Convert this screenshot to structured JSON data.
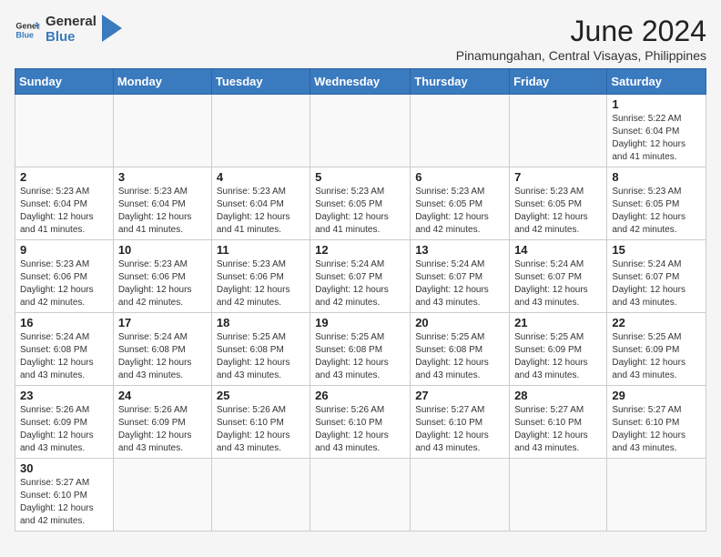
{
  "header": {
    "logo_general": "General",
    "logo_blue": "Blue",
    "month_year": "June 2024",
    "location": "Pinamungahan, Central Visayas, Philippines"
  },
  "days_of_week": [
    "Sunday",
    "Monday",
    "Tuesday",
    "Wednesday",
    "Thursday",
    "Friday",
    "Saturday"
  ],
  "weeks": [
    {
      "cells": [
        {
          "day": "",
          "info": ""
        },
        {
          "day": "",
          "info": ""
        },
        {
          "day": "",
          "info": ""
        },
        {
          "day": "",
          "info": ""
        },
        {
          "day": "",
          "info": ""
        },
        {
          "day": "",
          "info": ""
        },
        {
          "day": "1",
          "info": "Sunrise: 5:22 AM\nSunset: 6:04 PM\nDaylight: 12 hours and 41 minutes."
        }
      ]
    },
    {
      "cells": [
        {
          "day": "2",
          "info": "Sunrise: 5:23 AM\nSunset: 6:04 PM\nDaylight: 12 hours and 41 minutes."
        },
        {
          "day": "3",
          "info": "Sunrise: 5:23 AM\nSunset: 6:04 PM\nDaylight: 12 hours and 41 minutes."
        },
        {
          "day": "4",
          "info": "Sunrise: 5:23 AM\nSunset: 6:04 PM\nDaylight: 12 hours and 41 minutes."
        },
        {
          "day": "5",
          "info": "Sunrise: 5:23 AM\nSunset: 6:05 PM\nDaylight: 12 hours and 41 minutes."
        },
        {
          "day": "6",
          "info": "Sunrise: 5:23 AM\nSunset: 6:05 PM\nDaylight: 12 hours and 42 minutes."
        },
        {
          "day": "7",
          "info": "Sunrise: 5:23 AM\nSunset: 6:05 PM\nDaylight: 12 hours and 42 minutes."
        },
        {
          "day": "8",
          "info": "Sunrise: 5:23 AM\nSunset: 6:05 PM\nDaylight: 12 hours and 42 minutes."
        }
      ]
    },
    {
      "cells": [
        {
          "day": "9",
          "info": "Sunrise: 5:23 AM\nSunset: 6:06 PM\nDaylight: 12 hours and 42 minutes."
        },
        {
          "day": "10",
          "info": "Sunrise: 5:23 AM\nSunset: 6:06 PM\nDaylight: 12 hours and 42 minutes."
        },
        {
          "day": "11",
          "info": "Sunrise: 5:23 AM\nSunset: 6:06 PM\nDaylight: 12 hours and 42 minutes."
        },
        {
          "day": "12",
          "info": "Sunrise: 5:24 AM\nSunset: 6:07 PM\nDaylight: 12 hours and 42 minutes."
        },
        {
          "day": "13",
          "info": "Sunrise: 5:24 AM\nSunset: 6:07 PM\nDaylight: 12 hours and 43 minutes."
        },
        {
          "day": "14",
          "info": "Sunrise: 5:24 AM\nSunset: 6:07 PM\nDaylight: 12 hours and 43 minutes."
        },
        {
          "day": "15",
          "info": "Sunrise: 5:24 AM\nSunset: 6:07 PM\nDaylight: 12 hours and 43 minutes."
        }
      ]
    },
    {
      "cells": [
        {
          "day": "16",
          "info": "Sunrise: 5:24 AM\nSunset: 6:08 PM\nDaylight: 12 hours and 43 minutes."
        },
        {
          "day": "17",
          "info": "Sunrise: 5:24 AM\nSunset: 6:08 PM\nDaylight: 12 hours and 43 minutes."
        },
        {
          "day": "18",
          "info": "Sunrise: 5:25 AM\nSunset: 6:08 PM\nDaylight: 12 hours and 43 minutes."
        },
        {
          "day": "19",
          "info": "Sunrise: 5:25 AM\nSunset: 6:08 PM\nDaylight: 12 hours and 43 minutes."
        },
        {
          "day": "20",
          "info": "Sunrise: 5:25 AM\nSunset: 6:08 PM\nDaylight: 12 hours and 43 minutes."
        },
        {
          "day": "21",
          "info": "Sunrise: 5:25 AM\nSunset: 6:09 PM\nDaylight: 12 hours and 43 minutes."
        },
        {
          "day": "22",
          "info": "Sunrise: 5:25 AM\nSunset: 6:09 PM\nDaylight: 12 hours and 43 minutes."
        }
      ]
    },
    {
      "cells": [
        {
          "day": "23",
          "info": "Sunrise: 5:26 AM\nSunset: 6:09 PM\nDaylight: 12 hours and 43 minutes."
        },
        {
          "day": "24",
          "info": "Sunrise: 5:26 AM\nSunset: 6:09 PM\nDaylight: 12 hours and 43 minutes."
        },
        {
          "day": "25",
          "info": "Sunrise: 5:26 AM\nSunset: 6:10 PM\nDaylight: 12 hours and 43 minutes."
        },
        {
          "day": "26",
          "info": "Sunrise: 5:26 AM\nSunset: 6:10 PM\nDaylight: 12 hours and 43 minutes."
        },
        {
          "day": "27",
          "info": "Sunrise: 5:27 AM\nSunset: 6:10 PM\nDaylight: 12 hours and 43 minutes."
        },
        {
          "day": "28",
          "info": "Sunrise: 5:27 AM\nSunset: 6:10 PM\nDaylight: 12 hours and 43 minutes."
        },
        {
          "day": "29",
          "info": "Sunrise: 5:27 AM\nSunset: 6:10 PM\nDaylight: 12 hours and 43 minutes."
        }
      ]
    },
    {
      "cells": [
        {
          "day": "30",
          "info": "Sunrise: 5:27 AM\nSunset: 6:10 PM\nDaylight: 12 hours and 42 minutes."
        },
        {
          "day": "",
          "info": ""
        },
        {
          "day": "",
          "info": ""
        },
        {
          "day": "",
          "info": ""
        },
        {
          "day": "",
          "info": ""
        },
        {
          "day": "",
          "info": ""
        },
        {
          "day": "",
          "info": ""
        }
      ]
    }
  ]
}
